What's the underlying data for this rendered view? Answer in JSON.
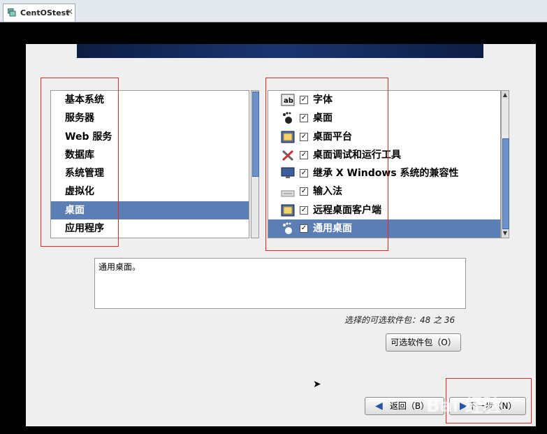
{
  "vm_tab": {
    "title": "CentOStest",
    "close": "✕"
  },
  "left_list": {
    "items": [
      {
        "label": "基本系统"
      },
      {
        "label": "服务器"
      },
      {
        "label": "Web 服务"
      },
      {
        "label": "数据库"
      },
      {
        "label": "系统管理"
      },
      {
        "label": "虚拟化"
      },
      {
        "label": "桌面"
      },
      {
        "label": "应用程序"
      }
    ],
    "selected": "桌面"
  },
  "right_list": {
    "items": [
      {
        "label": "字体",
        "icon": "font-icon",
        "checked": true
      },
      {
        "label": "桌面",
        "icon": "gnome-foot-icon",
        "checked": true
      },
      {
        "label": "桌面平台",
        "icon": "desktop-platform-icon",
        "checked": true
      },
      {
        "label": "桌面调试和运行工具",
        "icon": "tools-icon",
        "checked": true
      },
      {
        "label": "继承 X Windows 系统的兼容性",
        "icon": "monitor-icon",
        "checked": true
      },
      {
        "label": "输入法",
        "icon": "keyboard-icon",
        "checked": true
      },
      {
        "label": "远程桌面客户端",
        "icon": "remote-desktop-icon",
        "checked": true
      },
      {
        "label": "通用桌面",
        "icon": "gnome-foot-icon",
        "checked": true
      }
    ],
    "selected": "通用桌面"
  },
  "description": {
    "text": "通用桌面。"
  },
  "package_count": {
    "text": "选择的可选软件包：48 之 36"
  },
  "buttons": {
    "optional_packages": "可选软件包（O）",
    "back": "返回（B）",
    "next": "下一步（N）"
  },
  "watermark": {
    "text": "Bai 经验"
  },
  "colors": {
    "selection": "#5b7eb5",
    "annotation": "#e22222",
    "banner": "#1b3570"
  }
}
